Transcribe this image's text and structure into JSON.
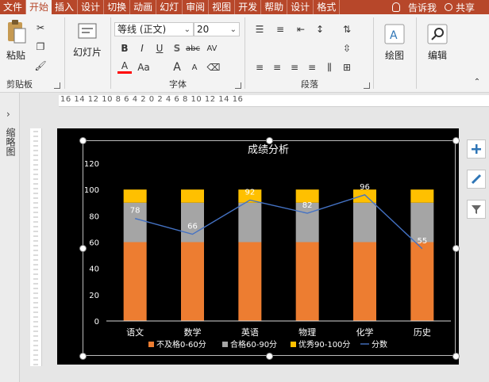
{
  "tabs": [
    "文件",
    "开始",
    "插入",
    "设计",
    "切换",
    "动画",
    "幻灯",
    "审阅",
    "视图",
    "开发",
    "帮助",
    "设计",
    "格式"
  ],
  "active_tab": "开始",
  "tell_me": "告诉我",
  "share": "共享",
  "clipboard": {
    "paste": "粘贴",
    "label": "剪贴板"
  },
  "slides": {
    "label": "幻灯片"
  },
  "font": {
    "name": "等线 (正文)",
    "size": "20",
    "label": "字体",
    "grow": "A",
    "shrink": "A",
    "case": "Aa",
    "bold": "B",
    "italic": "I",
    "underline": "U",
    "shadow": "S",
    "strike": "abc",
    "spacing": "AV",
    "color": "A"
  },
  "paragraph": {
    "label": "段落"
  },
  "drawing": {
    "label": "绘图"
  },
  "editing": {
    "label": "编辑"
  },
  "ruler_numbers": "16 14 12 10 8 6 4 2 0 2 4 6 8 10 12 14 16",
  "thumb_label": "缩略图",
  "colors": {
    "accent": "#b7472a",
    "fail": "#ed7d31",
    "pass": "#a5a5a5",
    "excellent": "#ffc000",
    "score_line": "#4472c4"
  },
  "chart_data": {
    "type": "bar",
    "stacked": true,
    "title": "成绩分析",
    "categories": [
      "语文",
      "数学",
      "英语",
      "物理",
      "化学",
      "历史"
    ],
    "ylim": [
      0,
      120
    ],
    "yticks": [
      0,
      20,
      40,
      60,
      80,
      100,
      120
    ],
    "series": [
      {
        "name": "不及格0-60分",
        "type": "bar",
        "values": [
          60,
          60,
          60,
          60,
          60,
          60
        ]
      },
      {
        "name": "合格60-90分",
        "type": "bar",
        "values": [
          30,
          30,
          30,
          30,
          30,
          30
        ]
      },
      {
        "name": "优秀90-100分",
        "type": "bar",
        "values": [
          10,
          10,
          10,
          10,
          10,
          10
        ]
      },
      {
        "name": "分数",
        "type": "line",
        "values": [
          78,
          66,
          92,
          82,
          96,
          55
        ]
      }
    ],
    "legend": "bottom",
    "grid": false
  }
}
